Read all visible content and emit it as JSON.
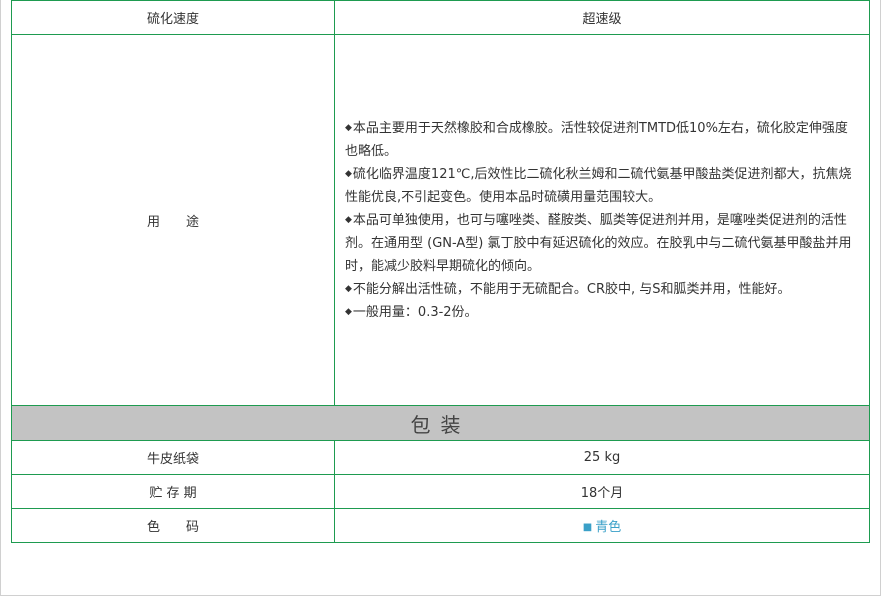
{
  "rows": {
    "speed_label": "硫化速度",
    "speed_value": "超速级",
    "usage_label": "用　　途",
    "usage_items": [
      "本品主要用于天然橡胶和合成橡胶。活性较促进剂TMTD低10%左右，硫化胶定伸强度也略低。",
      "硫化临界温度121℃,后效性比二硫化秋兰姆和二硫代氨基甲酸盐类促进剂都大，抗焦烧性能优良,不引起变色。使用本品时硫磺用量范围较大。",
      "本品可单独使用，也可与噻唑类、醛胺类、胍类等促进剂并用，是噻唑类促进剂的活性剂。在通用型 (GN-A型) 氯丁胶中有延迟硫化的效应。在胶乳中与二硫代氨基甲酸盐并用时，能减少胶料早期硫化的倾向。",
      "不能分解出活性硫，不能用于无硫配合。CR胶中, 与S和胍类并用，性能好。",
      "一般用量：0.3-2份。"
    ],
    "packaging_header": "包装",
    "bag_label": "牛皮纸袋",
    "bag_value": "25 kg",
    "storage_label": "贮 存 期",
    "storage_value": "18个月",
    "color_label": "色　　码",
    "color_value": "青色"
  },
  "colors": {
    "border": "#1e9b50",
    "header_bg": "#c3c3c3",
    "color_swatch": "#3aa0c8"
  }
}
